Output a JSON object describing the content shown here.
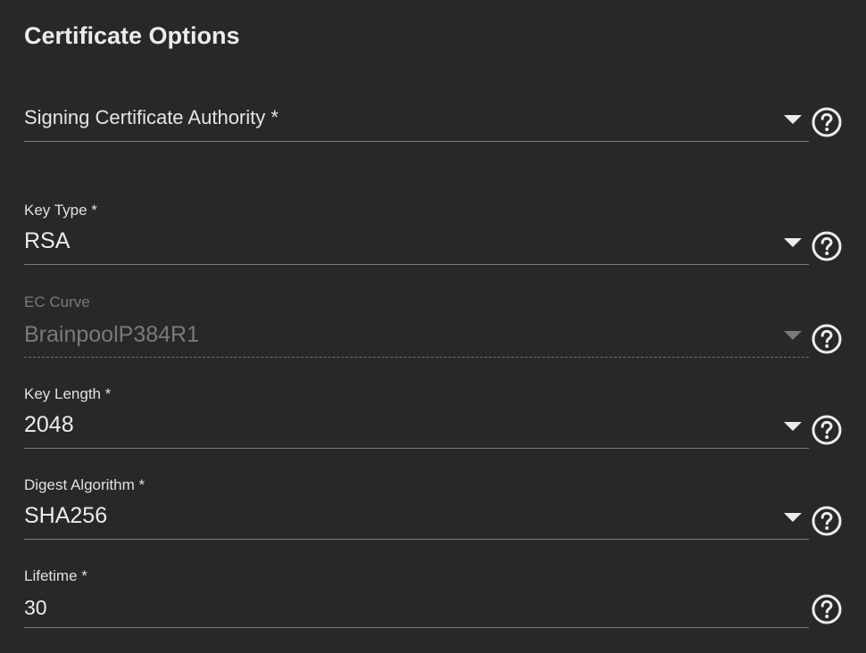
{
  "card": {
    "title": "Certificate Options"
  },
  "fields": {
    "signing_ca": {
      "placeholder": "Signing Certificate Authority *",
      "icon": "chevron-down-icon",
      "help_icon": "help-circle-icon"
    },
    "key_type": {
      "label": "Key Type *",
      "value": "RSA"
    },
    "ec_curve": {
      "label": "EC Curve",
      "value": "BrainpoolP384R1",
      "disabled": true
    },
    "key_length": {
      "label": "Key Length *",
      "value": "2048"
    },
    "digest_algorithm": {
      "label": "Digest Algorithm *",
      "value": "SHA256"
    },
    "lifetime": {
      "label": "Lifetime *",
      "value": "30"
    }
  },
  "colors": {
    "background": "#282828",
    "text": "#ececec",
    "disabled_text": "#7a7a7a",
    "underline": "#7c7c7c"
  }
}
